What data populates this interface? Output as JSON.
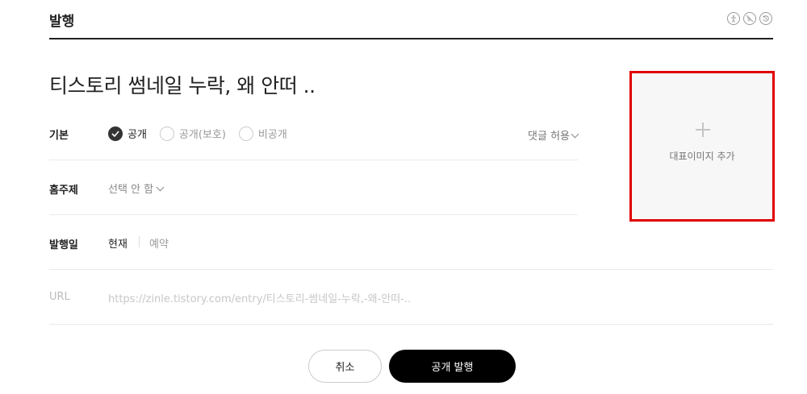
{
  "header": {
    "title": "발행",
    "icons": [
      "accessibility-icon",
      "no-ads-icon",
      "history-icon"
    ]
  },
  "post": {
    "title": "티스토리 썸네일 누락, 왜 안떠 .."
  },
  "visibility": {
    "label": "기본",
    "options": [
      {
        "label": "공개",
        "checked": true
      },
      {
        "label": "공개(보호)",
        "checked": false
      },
      {
        "label": "비공개",
        "checked": false
      }
    ],
    "comment_toggle": "댓글 허용"
  },
  "category": {
    "label": "홈주제",
    "value": "선택 안 함"
  },
  "publish_date": {
    "label": "발행일",
    "now": "현재",
    "reserve": "예약"
  },
  "url": {
    "label": "URL",
    "value": "https://zinle.tistory.com/entry/티스토리-썸네일-누락,-왜-안떠-.."
  },
  "cover": {
    "label": "대표이미지 추가"
  },
  "actions": {
    "cancel": "취소",
    "publish": "공개 발행"
  },
  "colors": {
    "highlight": "#e00000",
    "primary_button": "#000000"
  }
}
